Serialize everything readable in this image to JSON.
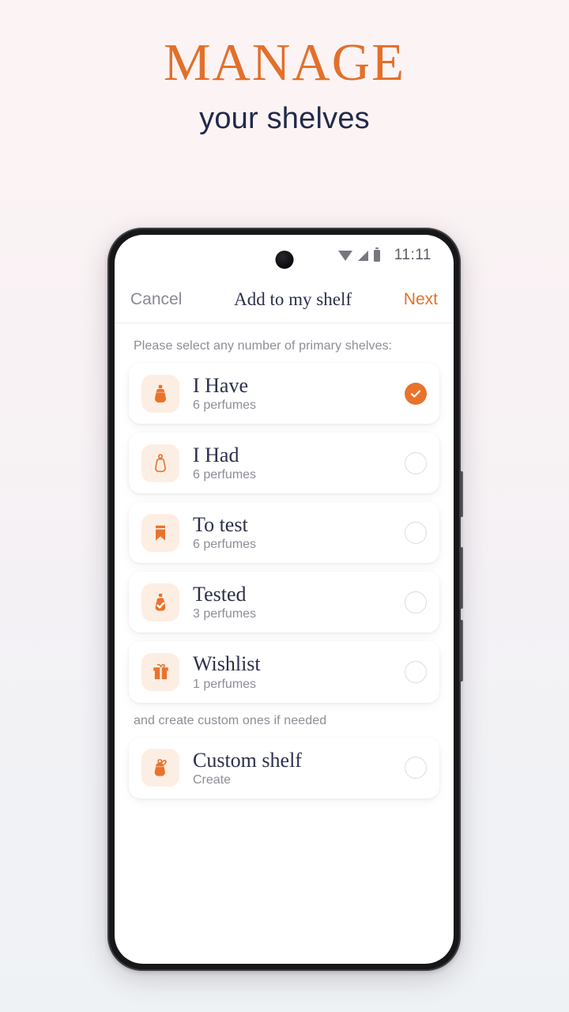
{
  "promo": {
    "headline": "MANAGE",
    "subheadline": "your shelves",
    "headline_color": "#e2702b",
    "subheadline_color": "#222a4a"
  },
  "statusbar": {
    "time": "11:11",
    "icons": [
      "wifi-icon",
      "signal-icon",
      "battery-icon"
    ]
  },
  "navbar": {
    "cancel_label": "Cancel",
    "title": "Add to my shelf",
    "next_label": "Next",
    "next_color": "#e2702b"
  },
  "primary_section": {
    "label": "Please select any number of primary shelves:",
    "shelves": [
      {
        "title": "I Have",
        "subtitle": "6 perfumes",
        "icon": "perfume-bottle-filled-icon",
        "selected": true
      },
      {
        "title": "I Had",
        "subtitle": "6 perfumes",
        "icon": "perfume-bottle-outline-icon",
        "selected": false
      },
      {
        "title": "To test",
        "subtitle": "6 perfumes",
        "icon": "bookmark-icon",
        "selected": false
      },
      {
        "title": "Tested",
        "subtitle": "3 perfumes",
        "icon": "perfume-bottle-check-icon",
        "selected": false
      },
      {
        "title": "Wishlist",
        "subtitle": "1 perfumes",
        "icon": "gift-icon",
        "selected": false
      }
    ]
  },
  "custom_section": {
    "label": "and create custom ones if needed",
    "shelves": [
      {
        "title": "Custom shelf",
        "subtitle": "Create",
        "icon": "perfume-spray-icon",
        "selected": false
      }
    ]
  },
  "theme": {
    "accent": "#e8732c",
    "tile_bg": "#fdeee4",
    "text_dark": "#2b2f4c",
    "text_muted": "#8d8d96",
    "screen_bg": "#ffffff",
    "page_bg_top": "#fcf4f4",
    "page_bg_bottom": "#eff2f5"
  }
}
